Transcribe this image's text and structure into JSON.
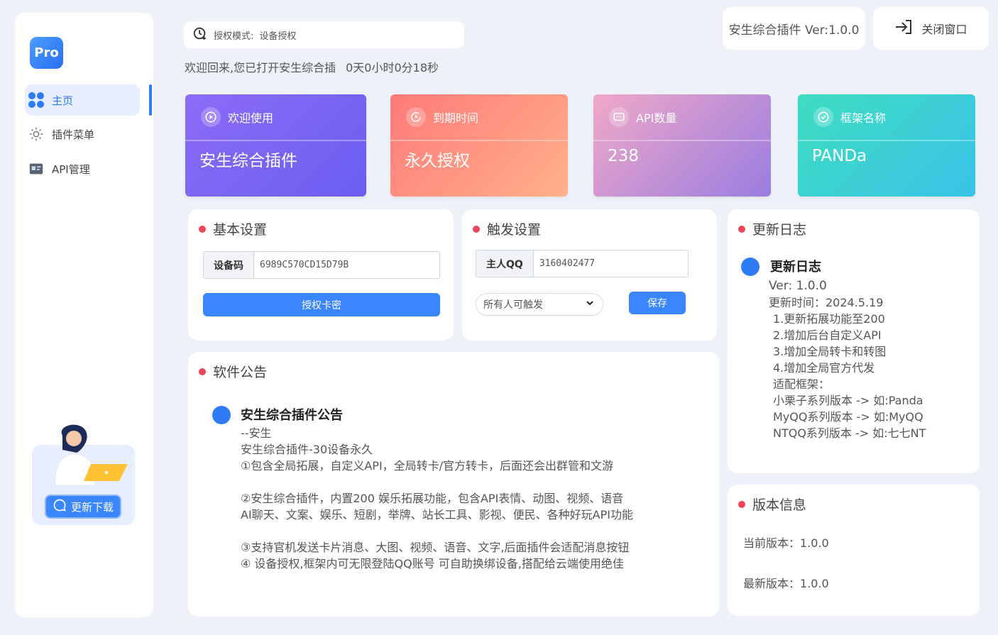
{
  "sidebar": {
    "logo": "Pro",
    "items": [
      {
        "label": "主页",
        "icon": "grid-icon"
      },
      {
        "label": "插件菜单",
        "icon": "gear-icon"
      },
      {
        "label": "API管理",
        "icon": "api-icon"
      }
    ],
    "promo_button": "更新下载"
  },
  "top": {
    "auth_mode_label": "授权模式:",
    "auth_mode_value": "设备授权",
    "welcome": "欢迎回来,您已打开安生综合插",
    "uptime": "0天0小时0分18秒",
    "version": "安生综合插件 Ver:1.0.0",
    "close": "关闭窗口"
  },
  "cards": [
    {
      "title": "欢迎使用",
      "value": "安生综合插件"
    },
    {
      "title": "到期时间",
      "value": "永久授权"
    },
    {
      "title": "API数量",
      "value": "238"
    },
    {
      "title": "框架名称",
      "value": "PANDa"
    }
  ],
  "basic": {
    "title": "基本设置",
    "device_label": "设备码",
    "device_value": "6989C570CD15D79B",
    "auth_button": "授权卡密"
  },
  "trigger": {
    "title": "触发设置",
    "owner_label": "主人QQ",
    "owner_value": "3160402477",
    "select_value": "所有人可触发",
    "save_button": "保存"
  },
  "notice": {
    "title": "软件公告",
    "heading": "安生综合插件公告",
    "lines": [
      "--安生",
      "安生综合插件-30设备永久",
      "①包含全局拓展，自定义API，全局转卡/官方转卡，后面还会出群管和文游",
      "",
      "②安生综合插件，内置200 娱乐拓展功能，包含API表情、动图、视频、语音",
      "AI聊天、文案、娱乐、短剧，举牌、站长工具、影视、便民、各种好玩API功能",
      "",
      "③支持官机发送卡片消息、大图、视频、语音、文字,后面插件会适配消息按钮",
      "④ 设备授权,框架内可无限登陆QQ账号  可自助换绑设备,搭配给云端使用绝佳"
    ]
  },
  "changelog": {
    "title": "更新日志",
    "heading": "更新日志",
    "version": "Ver: 1.0.0",
    "date": "更新时间：2024.5.19",
    "lines": [
      "1.更新拓展功能至200",
      "2.增加后台自定义API",
      "3.增加全局转卡和转图",
      "4.增加全局官方代发",
      "适配框架：",
      "小栗子系列版本 -> 如:Panda",
      "MyQQ系列版本 -> 如:MyQQ",
      "NTQQ系列版本 -> 如:七七NT"
    ]
  },
  "version_info": {
    "title": "版本信息",
    "current": "当前版本：1.0.0",
    "latest": "最新版本：1.0.0"
  }
}
